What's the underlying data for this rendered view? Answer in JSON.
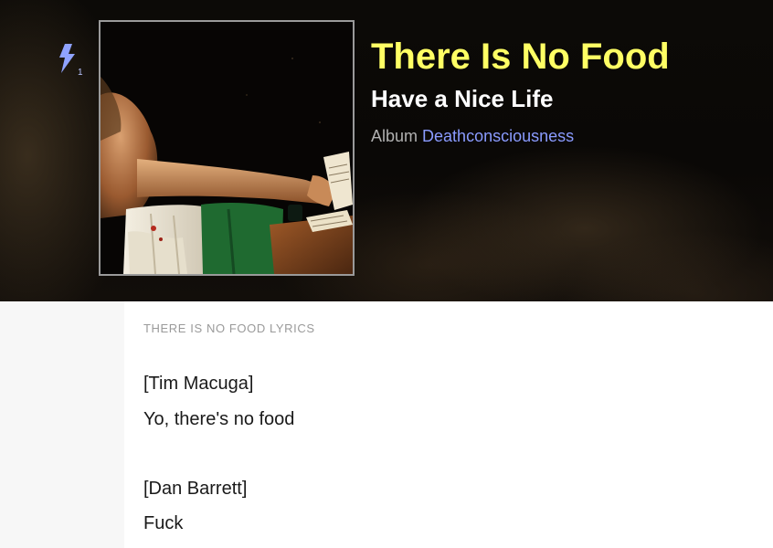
{
  "song": {
    "title": "There Is No Food",
    "artist": "Have a Nice Life",
    "album_label": "Album",
    "album_name": "Deathconsciousness"
  },
  "iq": {
    "icon": "lightning-bolt-icon",
    "count": "1"
  },
  "cover_art": {
    "icon": "album-cover-painting"
  },
  "lyrics": {
    "heading": "THERE IS NO FOOD LYRICS",
    "lines": [
      "[Tim Macuga]",
      "Yo, there's no food",
      "",
      "[Dan Barrett]",
      "Fuck"
    ]
  },
  "colors": {
    "title": "#ffff64",
    "artist": "#ffffff",
    "album_link": "#8a9bff",
    "accent_icon": "#8fa3ff"
  }
}
